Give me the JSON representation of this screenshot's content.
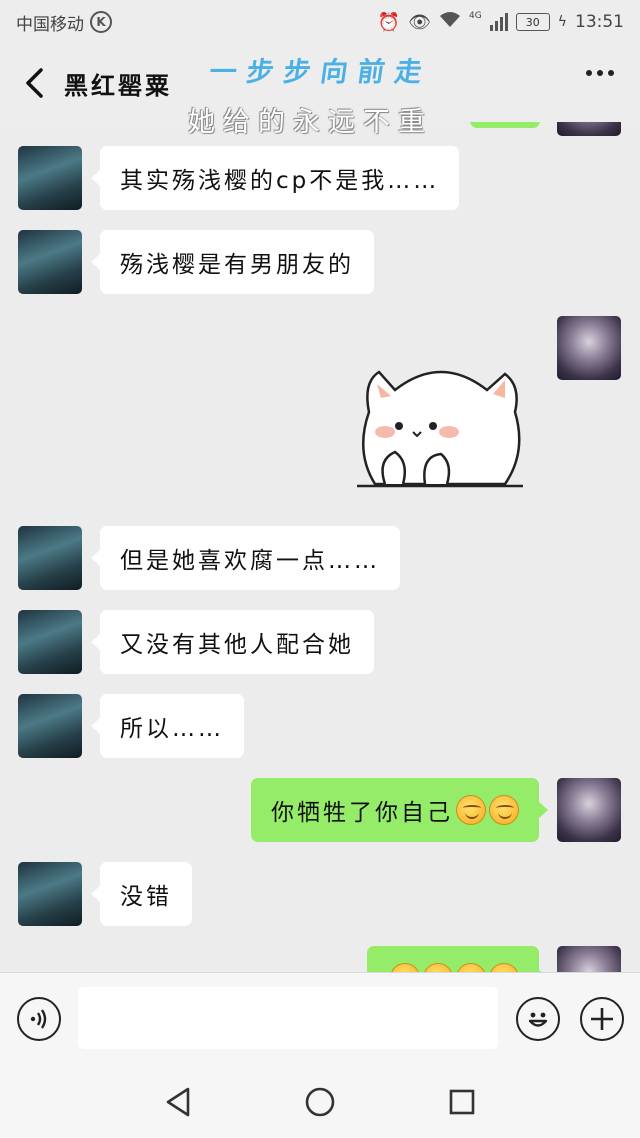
{
  "status_bar": {
    "carrier": "中国移动",
    "carrier_badge": "K",
    "network": "4G",
    "battery": "30",
    "time": "13:51"
  },
  "header": {
    "title": "黑红罂粟",
    "overlay_line1": "一步步向前走",
    "overlay_line2": "她给的永远不重"
  },
  "messages": [
    {
      "side": "left",
      "text": "其实殇浅樱的cp不是我……"
    },
    {
      "side": "left",
      "text": "殇浅樱是有男朋友的"
    },
    {
      "side": "right",
      "type": "sticker",
      "sticker": "white-cat-sticker"
    },
    {
      "side": "left",
      "text": "但是她喜欢腐一点……"
    },
    {
      "side": "left",
      "text": "又没有其他人配合她"
    },
    {
      "side": "left",
      "text": "所以……"
    },
    {
      "side": "right",
      "text": "你牺牲了你自己",
      "emoji_count": 2
    },
    {
      "side": "left",
      "text": "没错"
    },
    {
      "side": "right",
      "text": "",
      "emoji_count": 4
    }
  ],
  "input": {
    "placeholder": ""
  },
  "icons": {
    "back": "chevron-left-icon",
    "more": "more-icon",
    "voice": "voice-icon",
    "emoji": "emoji-icon",
    "add": "add-icon",
    "nav_back": "nav-back-icon",
    "nav_home": "nav-home-icon",
    "nav_recent": "nav-recent-icon"
  },
  "colors": {
    "background": "#ececec",
    "bubble_left": "#ffffff",
    "bubble_right": "#95ec69",
    "overlay_blue": "#4ab0e6"
  }
}
